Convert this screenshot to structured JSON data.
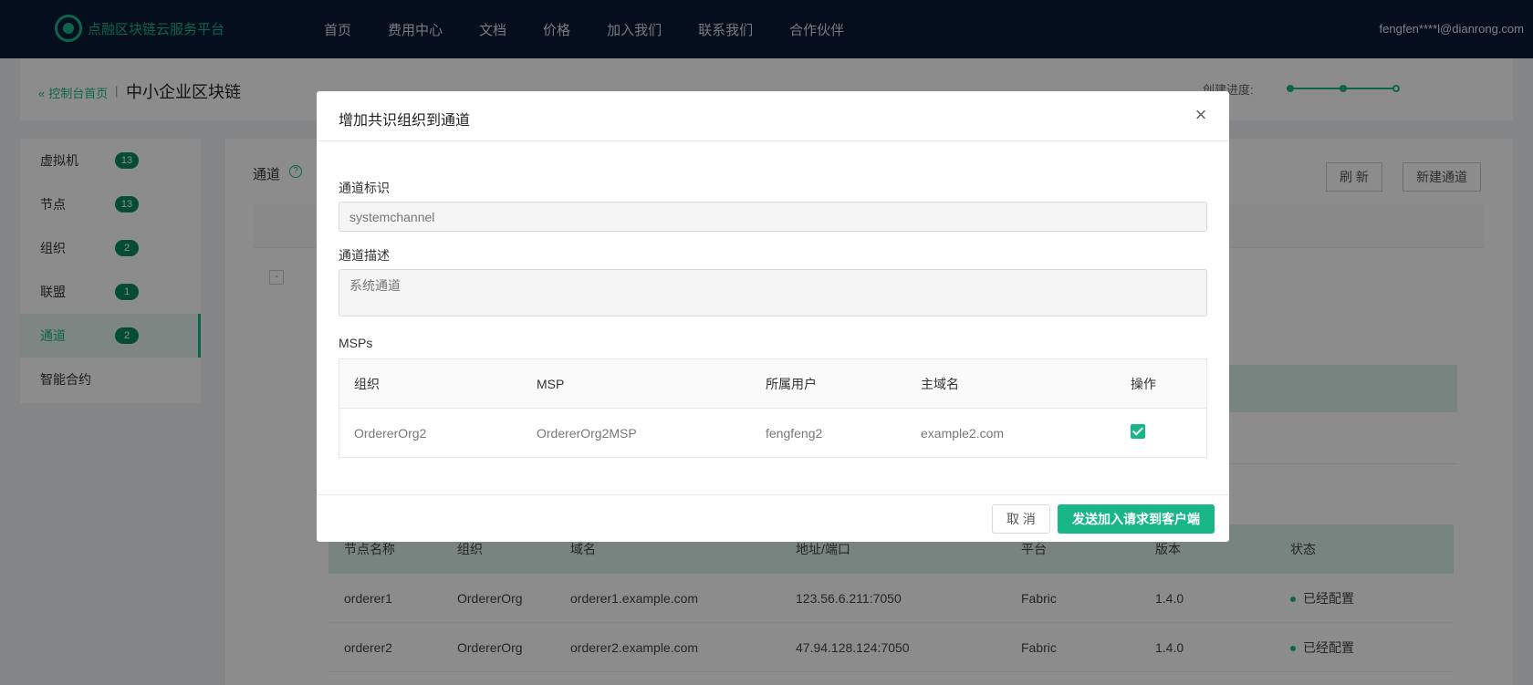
{
  "topnav": {
    "logo_text": "点融区块链云服务平台",
    "links": [
      "首页",
      "费用中心",
      "文档",
      "价格",
      "加入我们",
      "联系我们",
      "合作伙伴"
    ],
    "user": "fengfen****l@dianrong.com"
  },
  "subheader": {
    "back_label": "控制台首页",
    "separator": "|",
    "title": "中小企业区块链",
    "progress_label": "创建进度:"
  },
  "sidebar": {
    "items": [
      {
        "label": "虚拟机",
        "badge": "13"
      },
      {
        "label": "节点",
        "badge": "13"
      },
      {
        "label": "组织",
        "badge": "2"
      },
      {
        "label": "联盟",
        "badge": "1"
      },
      {
        "label": "通道",
        "badge": "2"
      },
      {
        "label": "智能合约",
        "badge": ""
      }
    ]
  },
  "main": {
    "title": "通道",
    "help": "?",
    "refresh_label": "刷 新",
    "new_channel_label": "新建通道",
    "expand": "-",
    "node_table": {
      "headers": [
        "节点名称",
        "组织",
        "域名",
        "地址/端口",
        "平台",
        "版本",
        "状态"
      ],
      "rows": [
        [
          "orderer1",
          "OrdererOrg",
          "orderer1.example.com",
          "123.56.6.211:7050",
          "Fabric",
          "1.4.0",
          "已经配置"
        ],
        [
          "orderer2",
          "OrdererOrg",
          "orderer2.example.com",
          "47.94.128.124:7050",
          "Fabric",
          "1.4.0",
          "已经配置"
        ]
      ]
    }
  },
  "modal": {
    "title": "增加共识组织到通道",
    "close": "×",
    "channel_id_label": "通道标识",
    "channel_id_placeholder": "systemchannel",
    "channel_desc_label": "通道描述",
    "channel_desc_placeholder": "系统通道",
    "msps_label": "MSPs",
    "msp_table": {
      "headers": [
        "组织",
        "MSP",
        "所属用户",
        "主域名",
        "操作"
      ],
      "rows": [
        [
          "OrdererOrg2",
          "OrdererOrg2MSP",
          "fengfeng2",
          "example2.com"
        ]
      ]
    },
    "cancel_label": "取 消",
    "submit_label": "发送加入请求到客户端"
  },
  "colors": {
    "brand": "#19b788",
    "nav_bg": "#0a1a33"
  }
}
